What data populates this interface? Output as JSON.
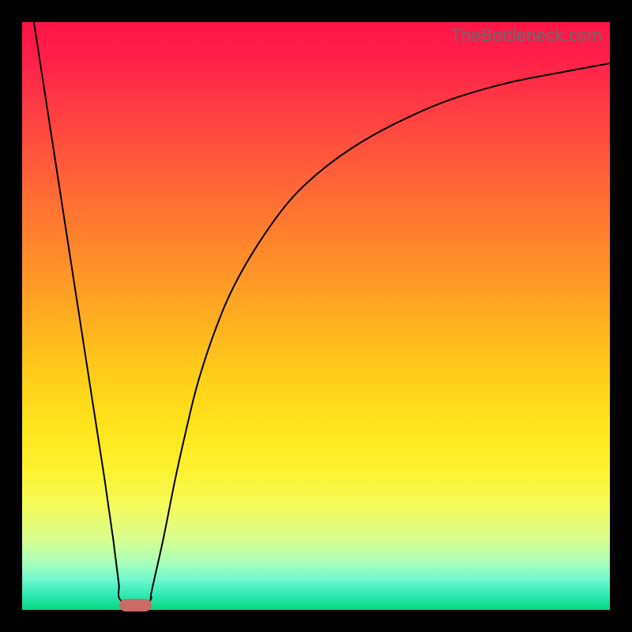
{
  "watermark": "TheBottleneck.com",
  "colors": {
    "frame": "#000000",
    "curve": "#000000",
    "marker": "#cc6b66"
  },
  "chart_data": {
    "type": "line",
    "title": "",
    "xlabel": "",
    "ylabel": "",
    "xlim": [
      0,
      100
    ],
    "ylim": [
      0,
      100
    ],
    "categories_note": "x is an unlabeled horizontal axis spanning the plot width; y is an unlabeled vertical axis spanning the plot height. Values are estimated from pixel positions; chart has no ticks or grid.",
    "series": [
      {
        "name": "left-branch",
        "description": "Straight descending segment from top-left toward the valley",
        "x": [
          2,
          5,
          8,
          11,
          14,
          15.5,
          16.5
        ],
        "y": [
          100,
          80.6,
          61.2,
          41.8,
          22.4,
          12.0,
          4.0
        ]
      },
      {
        "name": "valley-floor",
        "description": "Flat bottom near y=0",
        "x": [
          16.5,
          18.0,
          19.5,
          21.0,
          22.0
        ],
        "y": [
          2.0,
          0.8,
          0.5,
          0.8,
          2.0
        ]
      },
      {
        "name": "right-branch",
        "description": "Rising curve that decelerates toward the top-right",
        "x": [
          22,
          24,
          26,
          28,
          30,
          33,
          36,
          40,
          45,
          50,
          56,
          63,
          72,
          82,
          92,
          100
        ],
        "y": [
          3,
          12,
          22,
          31,
          39,
          48,
          55,
          62,
          69,
          74,
          78.5,
          82.5,
          86.5,
          89.5,
          91.5,
          93
        ]
      }
    ],
    "marker": {
      "description": "Rounded salmon bar at the valley bottom",
      "x_range": [
        16.5,
        22.0
      ],
      "y": 0
    },
    "background_gradient": {
      "top": "#ff1547",
      "mid": "#ffcd1a",
      "bottom": "#05d97d"
    }
  }
}
